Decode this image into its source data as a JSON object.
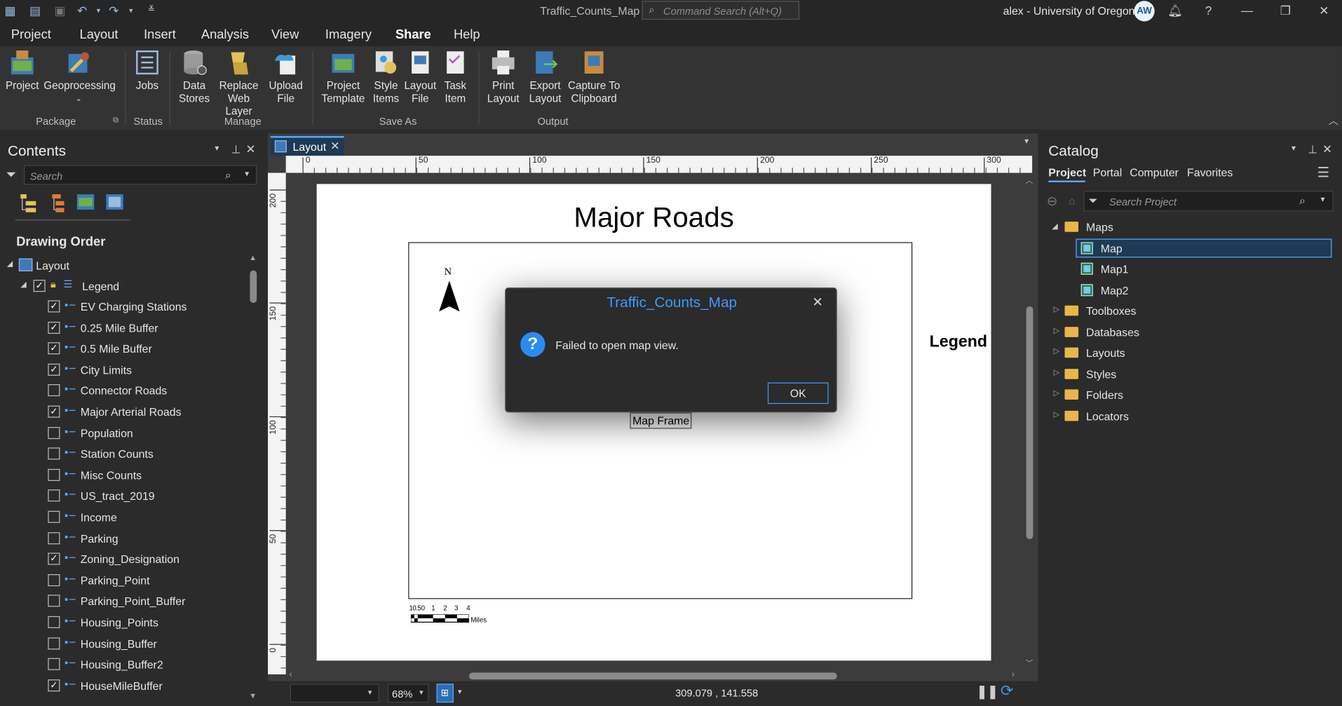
{
  "titlebar": {
    "doc_title": "Traffic_Counts_Map",
    "command_search_placeholder": "Command Search (Alt+Q)",
    "user": "alex - University of Oregon",
    "avatar_initials": "AW"
  },
  "menu": {
    "tabs": [
      "Project",
      "Layout",
      "Insert",
      "Analysis",
      "View",
      "Imagery",
      "Share",
      "Help"
    ],
    "active_tab": "Share"
  },
  "ribbon": {
    "buttons": {
      "project": "Project",
      "geoprocessing": "Geoprocessing",
      "jobs": "Jobs",
      "data_stores_1": "Data",
      "data_stores_2": "Stores",
      "replace_web_layer_1": "Replace",
      "replace_web_layer_2": "Web Layer",
      "upload_file_1": "Upload",
      "upload_file_2": "File",
      "project_template_1": "Project",
      "project_template_2": "Template",
      "style_items_1": "Style",
      "style_items_2": "Items",
      "layout_file_1": "Layout",
      "layout_file_2": "File",
      "task_item_1": "Task",
      "task_item_2": "Item",
      "print_layout_1": "Print",
      "print_layout_2": "Layout",
      "export_layout_1": "Export",
      "export_layout_2": "Layout",
      "capture_1": "Capture To",
      "capture_2": "Clipboard"
    },
    "groups": {
      "package": "Package",
      "status": "Status",
      "manage": "Manage",
      "save_as": "Save As",
      "output": "Output"
    }
  },
  "contents": {
    "title": "Contents",
    "search_placeholder": "Search",
    "section": "Drawing Order",
    "root": "Layout",
    "legend": "Legend",
    "layers": [
      {
        "name": "EV Charging Stations",
        "checked": true
      },
      {
        "name": "0.25 Mile Buffer",
        "checked": true
      },
      {
        "name": "0.5 Mile Buffer",
        "checked": true
      },
      {
        "name": "City Limits",
        "checked": true
      },
      {
        "name": "Connector Roads",
        "checked": false
      },
      {
        "name": "Major Arterial Roads",
        "checked": true
      },
      {
        "name": "Population",
        "checked": false
      },
      {
        "name": "Station Counts",
        "checked": false
      },
      {
        "name": "Misc Counts",
        "checked": false
      },
      {
        "name": "US_tract_2019",
        "checked": false
      },
      {
        "name": "Income",
        "checked": false
      },
      {
        "name": "Parking",
        "checked": false
      },
      {
        "name": "Zoning_Designation",
        "checked": true
      },
      {
        "name": "Parking_Point",
        "checked": false
      },
      {
        "name": "Parking_Point_Buffer",
        "checked": false
      },
      {
        "name": "Housing_Points",
        "checked": false
      },
      {
        "name": "Housing_Buffer",
        "checked": false
      },
      {
        "name": "Housing_Buffer2",
        "checked": false
      },
      {
        "name": "HouseMileBuffer",
        "checked": true
      }
    ]
  },
  "layout_view": {
    "tab": "Layout",
    "ruler_h": [
      "0",
      "50",
      "100",
      "150",
      "200",
      "250",
      "300"
    ],
    "ruler_v": [
      "200",
      "150",
      "100",
      "50",
      "0"
    ],
    "page_title": "Major Roads",
    "north_label": "N",
    "legend_label": "Legend",
    "map_frame_label": "Map Frame",
    "scalebar_ticks": [
      "1",
      "0.5",
      "0",
      "1",
      "2",
      "3",
      "4"
    ],
    "scalebar_units": "Miles",
    "zoom": "68%",
    "coordinates": "309.079 , 141.558"
  },
  "dialog": {
    "title": "Traffic_Counts_Map",
    "message": "Failed to open map view.",
    "ok": "OK"
  },
  "catalog": {
    "title": "Catalog",
    "tabs": [
      "Project",
      "Portal",
      "Computer",
      "Favorites"
    ],
    "active_tab": "Project",
    "search_placeholder": "Search Project",
    "maps_folder": "Maps",
    "maps": [
      "Map",
      "Map1",
      "Map2"
    ],
    "selected_map": "Map",
    "folders": [
      "Toolboxes",
      "Databases",
      "Layouts",
      "Styles",
      "Folders",
      "Locators"
    ]
  },
  "colors": {
    "accent": "#5aa9ff",
    "dialog_title": "#3b9cff",
    "selection": "#1e3a54"
  }
}
